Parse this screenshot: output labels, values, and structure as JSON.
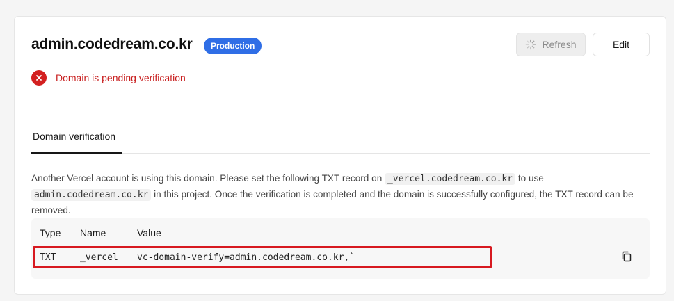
{
  "domain": {
    "name": "admin.codedream.co.kr",
    "environment_badge": "Production"
  },
  "toolbar": {
    "refresh_label": "Refresh",
    "edit_label": "Edit"
  },
  "status": {
    "icon": "error-circle-icon",
    "text": "Domain is pending verification",
    "color": "#c81e1e"
  },
  "tabs": [
    {
      "label": "Domain verification",
      "active": true
    }
  ],
  "description": {
    "part1": "Another Vercel account is using this domain. Please set the following TXT record on ",
    "code1": "_vercel.codedream.co.kr",
    "part2": " to use ",
    "code2": "admin.codedream.co.kr",
    "part3": " in this project. Once the verification is completed and the domain is successfully configured, the TXT record can be removed."
  },
  "records_table": {
    "columns": [
      "Type",
      "Name",
      "Value"
    ],
    "rows": [
      {
        "type": "TXT",
        "name": "_vercel",
        "value": "vc-domain-verify=admin.codedream.co.kr,`"
      }
    ]
  },
  "colors": {
    "accent": "#2f6ee6",
    "error": "#d32020",
    "highlight": "#d71920"
  }
}
